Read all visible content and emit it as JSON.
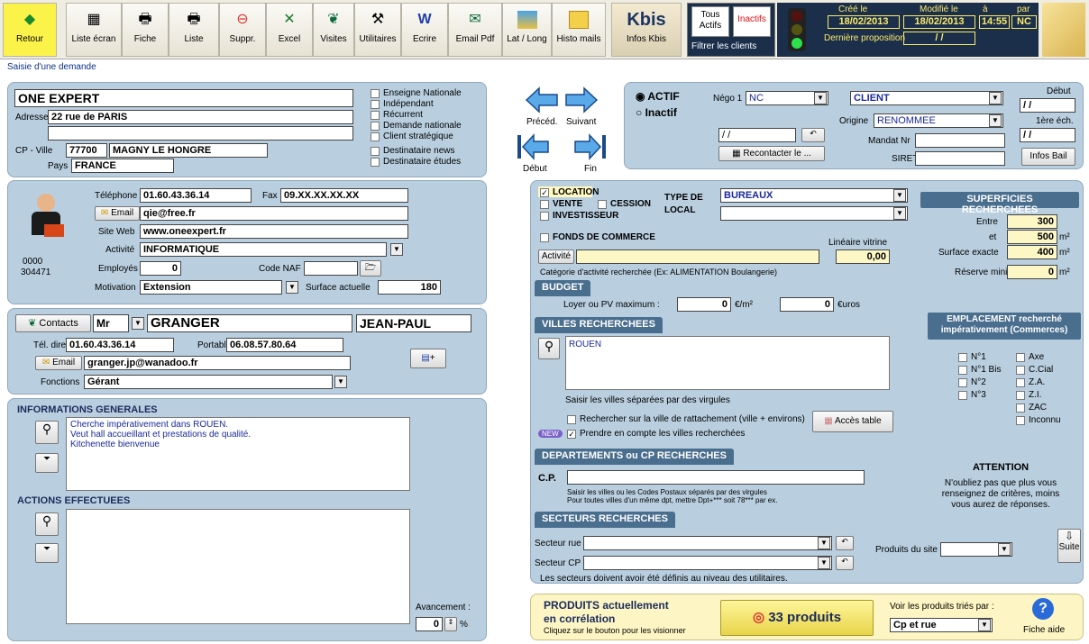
{
  "toolbar": {
    "retour": "Retour",
    "liste_ecran": "Liste écran",
    "fiche": "Fiche",
    "liste": "Liste",
    "suppr": "Suppr.",
    "excel": "Excel",
    "visites": "Visites",
    "utilitaires": "Utilitaires",
    "ecrire": "Ecrire",
    "email_pdf": "Email Pdf",
    "lat_long": "Lat / Long",
    "histo_mails": "Histo mails",
    "kbis": "Kbis",
    "infos_kbis": "Infos Kbis",
    "tous_actifs": "Tous Actifs",
    "inactifs": "Inactifs",
    "filtrer": "Filtrer les clients",
    "cree_le": "Créé le",
    "modifie_le": "Modifié le",
    "a": "à",
    "par": "par",
    "cree_val": "18/02/2013",
    "modifie_val": "18/02/2013",
    "heure_val": "14:55",
    "par_val": "NC",
    "derniere_prop": "Dernière proposition",
    "derniere_prop_val": "/ /"
  },
  "breadcrumb": "Saisie d'une demande",
  "company": {
    "name": "ONE EXPERT",
    "adresse_label": "Adresse",
    "adresse": "22 rue de PARIS",
    "adresse2": "",
    "cp_label": "CP - Ville",
    "cp": "77700",
    "ville": "MAGNY LE HONGRE",
    "pays_label": "Pays",
    "pays": "FRANCE",
    "flags": [
      "Enseigne Nationale",
      "Indépendant",
      "Récurrent",
      "Demande nationale",
      "Client stratégique",
      "Destinataire news",
      "Destinataire études"
    ]
  },
  "contact": {
    "telephone_label": "Téléphone",
    "telephone": "01.60.43.36.14",
    "fax_label": "Fax",
    "fax": "09.XX.XX.XX.XX",
    "email_label": "Email",
    "email": "qie@free.fr",
    "siteweb_label": "Site Web",
    "siteweb": "www.oneexpert.fr",
    "activite_label": "Activité",
    "activite": "INFORMATIQUE",
    "employes_label": "Employés",
    "employes": "0",
    "codenaf_label": "Code NAF",
    "codenaf": "",
    "motivation_label": "Motivation",
    "motivation": "Extension",
    "surface_label": "Surface actuelle",
    "surface": "180",
    "id1": "0000",
    "id2": "304471"
  },
  "person": {
    "contacts_label": "Contacts",
    "civilite": "Mr",
    "nom": "GRANGER",
    "prenom": "JEAN-PAUL",
    "teldirect_label": "Tél. direct",
    "teldirect": "01.60.43.36.14",
    "portable_label": "Portable",
    "portable": "06.08.57.80.64",
    "email_label": "Email",
    "email": "granger.jp@wanadoo.fr",
    "fonctions_label": "Fonctions",
    "fonctions": "Gérant"
  },
  "info": {
    "title": "INFORMATIONS GENERALES",
    "lines": [
      "Cherche impérativement dans ROUEN.",
      "Veut hall accueillant et prestations de qualité.",
      "Kitchenette bienvenue"
    ],
    "actions_title": "ACTIONS EFFECTUEES",
    "avancement_label": "Avancement :",
    "avancement": "0",
    "pct": "%"
  },
  "nav": {
    "preced": "Précéd.",
    "suivant": "Suivant",
    "debut": "Début",
    "fin": "Fin"
  },
  "status": {
    "actif": "ACTIF",
    "inactif": "Inactif",
    "nego_label": "Négo 1",
    "nego": "NC",
    "client": "CLIENT",
    "origine_label": "Origine",
    "origine": "RENOMMEE",
    "date_val": "/ /",
    "recontacter": "Recontacter le ...",
    "mandat_label": "Mandat Nr",
    "siret_label": "SIRET",
    "debut_label": "Début",
    "debut_val": "/ /",
    "premiere_label": "1ère éch.",
    "premiere_val": "/ /",
    "infos_bail": "Infos Bail"
  },
  "search": {
    "location": "LOCATION",
    "vente": "VENTE",
    "cession": "CESSION",
    "investisseur": "INVESTISSEUR",
    "type_local_label": "TYPE DE LOCAL",
    "type_local": "BUREAUX",
    "fonds": "FONDS DE COMMERCE",
    "lineaire_label": "Linéaire vitrine",
    "lineaire": "0,00",
    "activite_btn": "Activité",
    "activite_hint": "Catégorie d'activité recherchée (Ex: ALIMENTATION Boulangerie)",
    "superficies_title": "SUPERFICIES RECHERCHEES",
    "entre_label": "Entre",
    "entre": "300",
    "et_label": "et",
    "et": "500",
    "surface_exacte_label": "Surface exacte",
    "surface_exacte": "400",
    "unit": "m²",
    "reserve_label": "Réserve mini",
    "reserve": "0",
    "budget_title": "BUDGET",
    "loyer_label": "Loyer ou PV maximum :",
    "loyer": "0",
    "loyer_unit": "€/m²",
    "euros": "0",
    "euros_unit": "€uros",
    "villes_title": "VILLES RECHERCHEES",
    "villes": "ROUEN",
    "villes_hint": "Saisir les villes séparées par des virgules",
    "rattachement": "Rechercher sur la ville de rattachement (ville + environs)",
    "acces_table": "Accès table",
    "new_badge": "NEW",
    "prendre": "Prendre en compte les villes recherchées",
    "dept_title": "DEPARTEMENTS ou CP RECHERCHES",
    "cp_label": "C.P.",
    "cp_hint1": "Saisir les villes ou les Codes Postaux séparés par des virgules",
    "cp_hint2": "Pour toutes villes d'un même dpt, mettre Dpt+*** soit 78*** par ex.",
    "secteurs_title": "SECTEURS RECHERCHES",
    "secteur_rue_label": "Secteur rue",
    "secteur_cp_label": "Secteur CP",
    "secteurs_hint": "Les secteurs doivent avoir été définis au niveau des utilitaires.",
    "produits_site_label": "Produits du site",
    "suite": "Suite",
    "emplacement_title": "EMPLACEMENT recherché impérativement (Commerces)",
    "emplacements": [
      "N°1",
      "Axe",
      "N°1 Bis",
      "C.Cial",
      "N°2",
      "Z.A.",
      "N°3",
      "Z.I.",
      "",
      "ZAC",
      "",
      "Inconnu"
    ],
    "attention_title": "ATTENTION",
    "attention_text": "N'oubliez pas que plus vous renseignez de critères, moins vous aurez de réponses."
  },
  "produits": {
    "title1": "PRODUITS actuellement",
    "title2": "en corrélation",
    "hint": "Cliquez sur le bouton pour les visionner",
    "count": "33 produits",
    "tri_label": "Voir les produits triés par :",
    "tri": "Cp et rue",
    "fiche_aide": "Fiche aide"
  }
}
